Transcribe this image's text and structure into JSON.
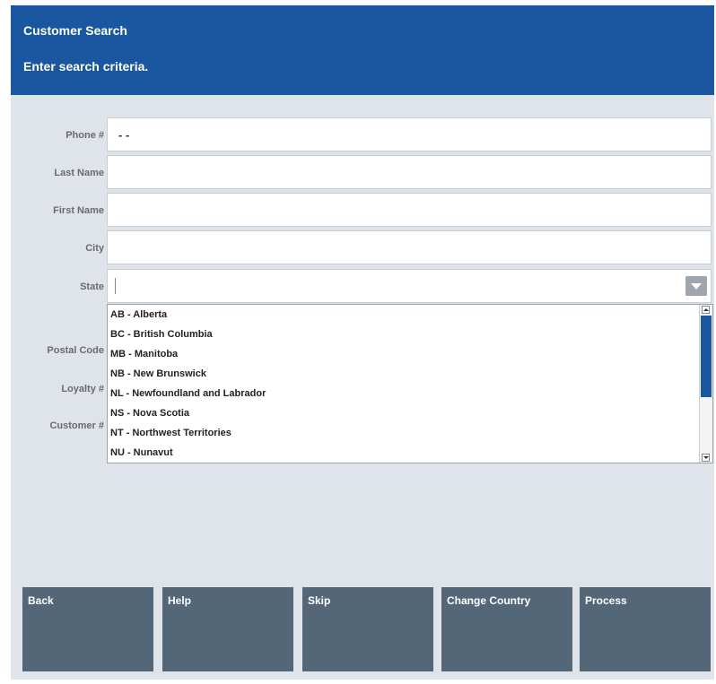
{
  "header": {
    "title": "Customer Search",
    "subtitle": "Enter search criteria."
  },
  "form": {
    "phone": {
      "label": "Phone #",
      "value": "- -"
    },
    "last_name": {
      "label": "Last Name",
      "value": ""
    },
    "first_name": {
      "label": "First Name",
      "value": ""
    },
    "city": {
      "label": "City",
      "value": ""
    },
    "state": {
      "label": "State",
      "value": ""
    },
    "postal_code": {
      "label": "Postal Code"
    },
    "loyalty": {
      "label": "Loyalty #"
    },
    "customer": {
      "label": "Customer #"
    }
  },
  "state_dropdown": {
    "options": [
      "AB - Alberta",
      "BC - British Columbia",
      "MB - Manitoba",
      "NB - New Brunswick",
      "NL - Newfoundland and Labrador",
      "NS - Nova Scotia",
      "NT - Northwest Territories",
      "NU - Nunavut"
    ],
    "scroll_position": 0.0,
    "visible_fraction": 0.6
  },
  "buttons": {
    "back": "Back",
    "help": "Help",
    "skip": "Skip",
    "change_country": "Change Country",
    "process": "Process"
  },
  "colors": {
    "header_bg": "#1b57a0",
    "panel_bg": "#dfe4ea",
    "button_bg": "#536779",
    "scroll_thumb": "#1b57a0"
  }
}
